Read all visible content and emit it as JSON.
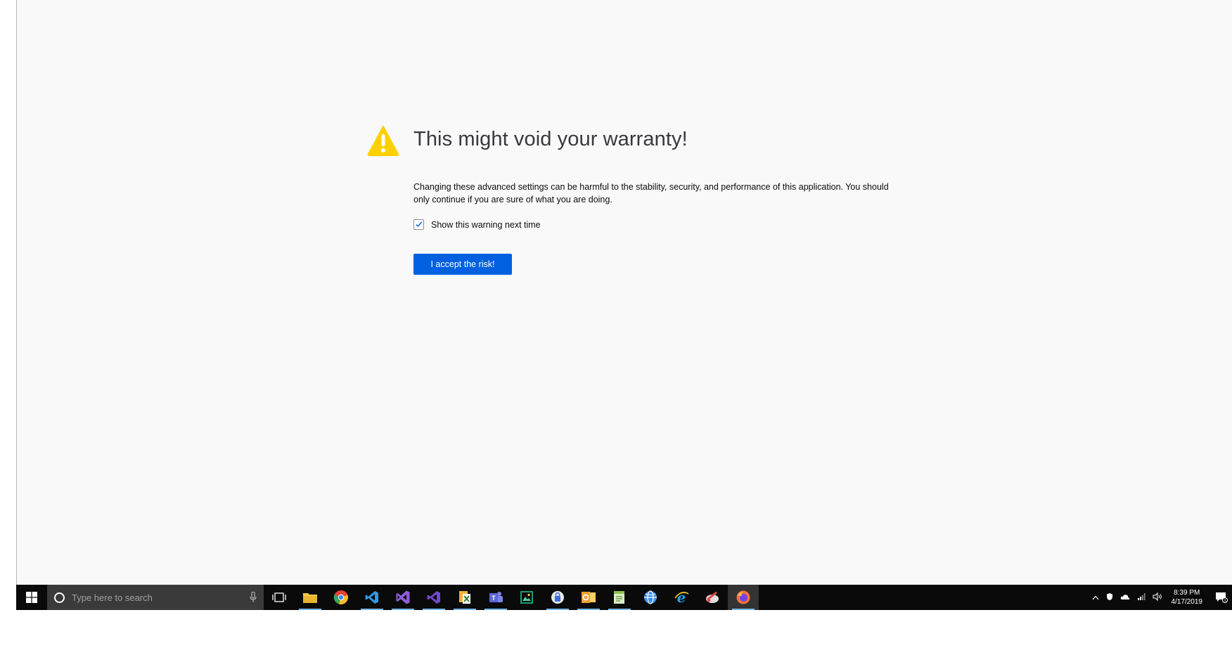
{
  "dialog": {
    "title": "This might void your warranty!",
    "description": "Changing these advanced settings can be harmful to the stability, security, and performance of this application. You should only continue if you are sure of what you are doing.",
    "checkbox_label": "Show this warning next time",
    "checkbox_checked": true,
    "accept_button_label": "I accept the risk!"
  },
  "taskbar": {
    "search_placeholder": "Type here to search",
    "apps": [
      {
        "name": "task-view",
        "color": "#ffffff"
      },
      {
        "name": "file-explorer",
        "color": "#f7c948"
      },
      {
        "name": "chrome",
        "color": "#e94235"
      },
      {
        "name": "vs-code",
        "color": "#2f9ae8"
      },
      {
        "name": "visual-studio",
        "color": "#8e5cd9"
      },
      {
        "name": "visual-studio-code-insiders",
        "color": "#6f4ac9"
      },
      {
        "name": "xps-viewer",
        "color": "#f2b134"
      },
      {
        "name": "teams",
        "color": "#5b67d8"
      },
      {
        "name": "photos",
        "color": "#1c9e75"
      },
      {
        "name": "keepass",
        "color": "#3a6fd8"
      },
      {
        "name": "outlook",
        "color": "#f0a030"
      },
      {
        "name": "notepad-plus",
        "color": "#8bc34a"
      },
      {
        "name": "browser-globe",
        "color": "#3b8ee8"
      },
      {
        "name": "internet-explorer",
        "color": "#1fa2e8"
      },
      {
        "name": "snipping-tool",
        "color": "#e04848"
      },
      {
        "name": "firefox",
        "color": "#ff7139"
      }
    ],
    "clock_time": "8:39 PM",
    "clock_date": "4/17/2019"
  }
}
